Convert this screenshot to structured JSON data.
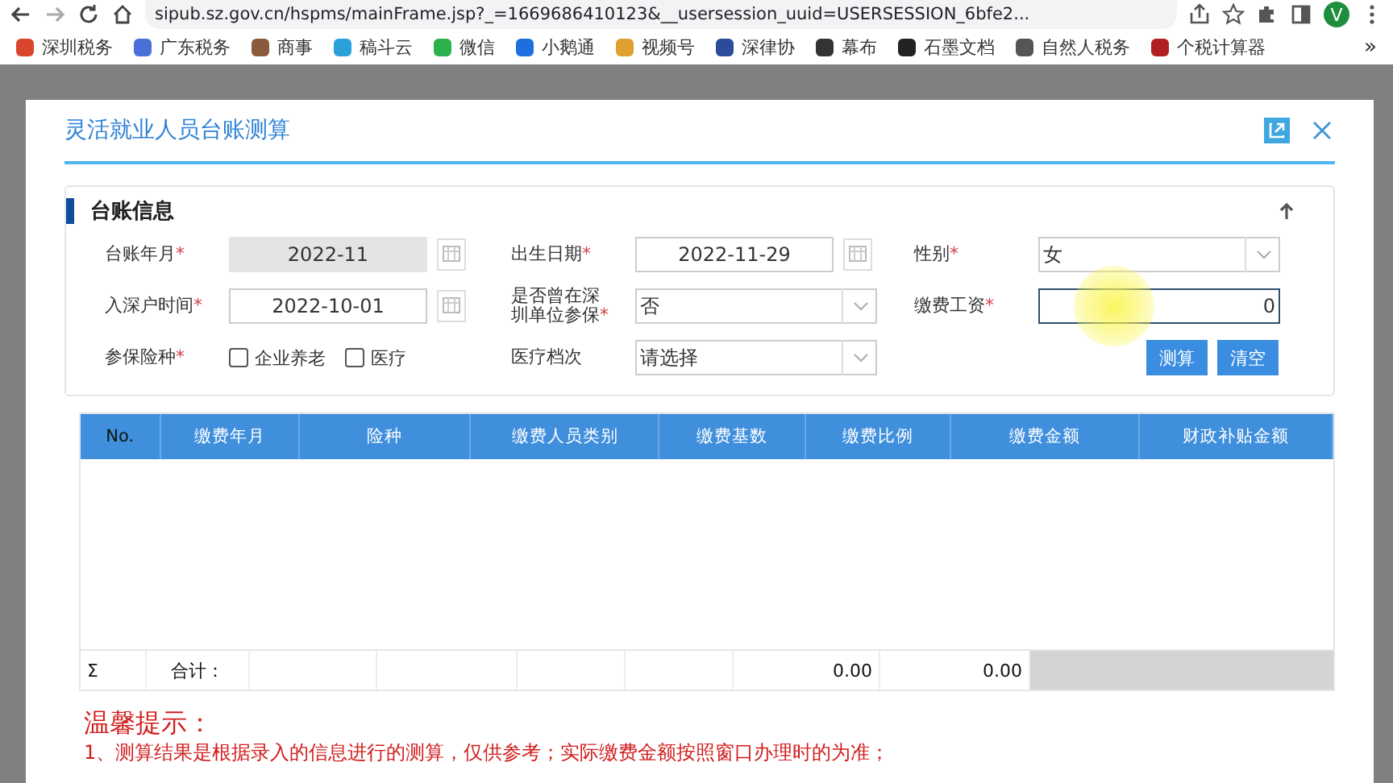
{
  "browser": {
    "url": "sipub.sz.gov.cn/hspms/mainFrame.jsp?_=1669686410123&__usersession_uuid=USERSESSION_6bfe2...",
    "avatar": "V",
    "bookmarks": [
      {
        "label": "深圳税务"
      },
      {
        "label": "广东税务"
      },
      {
        "label": "商事"
      },
      {
        "label": "稿斗云"
      },
      {
        "label": "微信"
      },
      {
        "label": "小鹅通"
      },
      {
        "label": "视频号"
      },
      {
        "label": "深律协"
      },
      {
        "label": "幕布"
      },
      {
        "label": "石墨文档"
      },
      {
        "label": "自然人税务"
      },
      {
        "label": "个税计算器"
      }
    ],
    "more": "»"
  },
  "dialog": {
    "title": "灵活就业人员台账测算",
    "section": {
      "title": "台账信息",
      "fields": [
        {
          "kind": "date",
          "label": "台账年月",
          "required_mark": "*",
          "value": "2022-11",
          "disabled": true
        },
        {
          "kind": "date",
          "label": "出生日期",
          "required_mark": "*",
          "value": "2022-11-29",
          "disabled": false
        },
        {
          "kind": "select",
          "label": "性别",
          "required_mark": "*",
          "value": "女"
        },
        {
          "kind": "date",
          "label": "入深户时间",
          "required_mark": "*",
          "value": "2022-10-01",
          "disabled": false
        },
        {
          "kind": "select",
          "label": "是否曾在深圳单位参保",
          "required_mark": "*",
          "value": "否"
        },
        {
          "kind": "text",
          "label": "缴费工资",
          "required_mark": "*",
          "value": "0",
          "focused": true
        },
        {
          "kind": "checks",
          "label": "参保险种",
          "required_mark": "*",
          "options": [
            {
              "label": "企业养老",
              "checked": false
            },
            {
              "label": "医疗",
              "checked": false
            }
          ]
        },
        {
          "kind": "select",
          "label": "医疗档次",
          "value": "请选择"
        },
        {
          "kind": "buttons",
          "buttons": [
            "测算",
            "清空"
          ]
        }
      ]
    },
    "table": {
      "columns": [
        "No.",
        "缴费年月",
        "险种",
        "缴费人员类别",
        "缴费基数",
        "缴费比例",
        "缴费金额",
        "财政补贴金额"
      ],
      "footer": {
        "sigma": "Σ",
        "label": "合计：",
        "amount": "0.00",
        "subsidy": "0.00"
      }
    },
    "tips": {
      "title": "温馨提示：",
      "lines": [
        "1、测算结果是根据录入的信息进行的测算，仅供参考；实际缴费金额按照窗口办理时的为准；"
      ]
    }
  }
}
